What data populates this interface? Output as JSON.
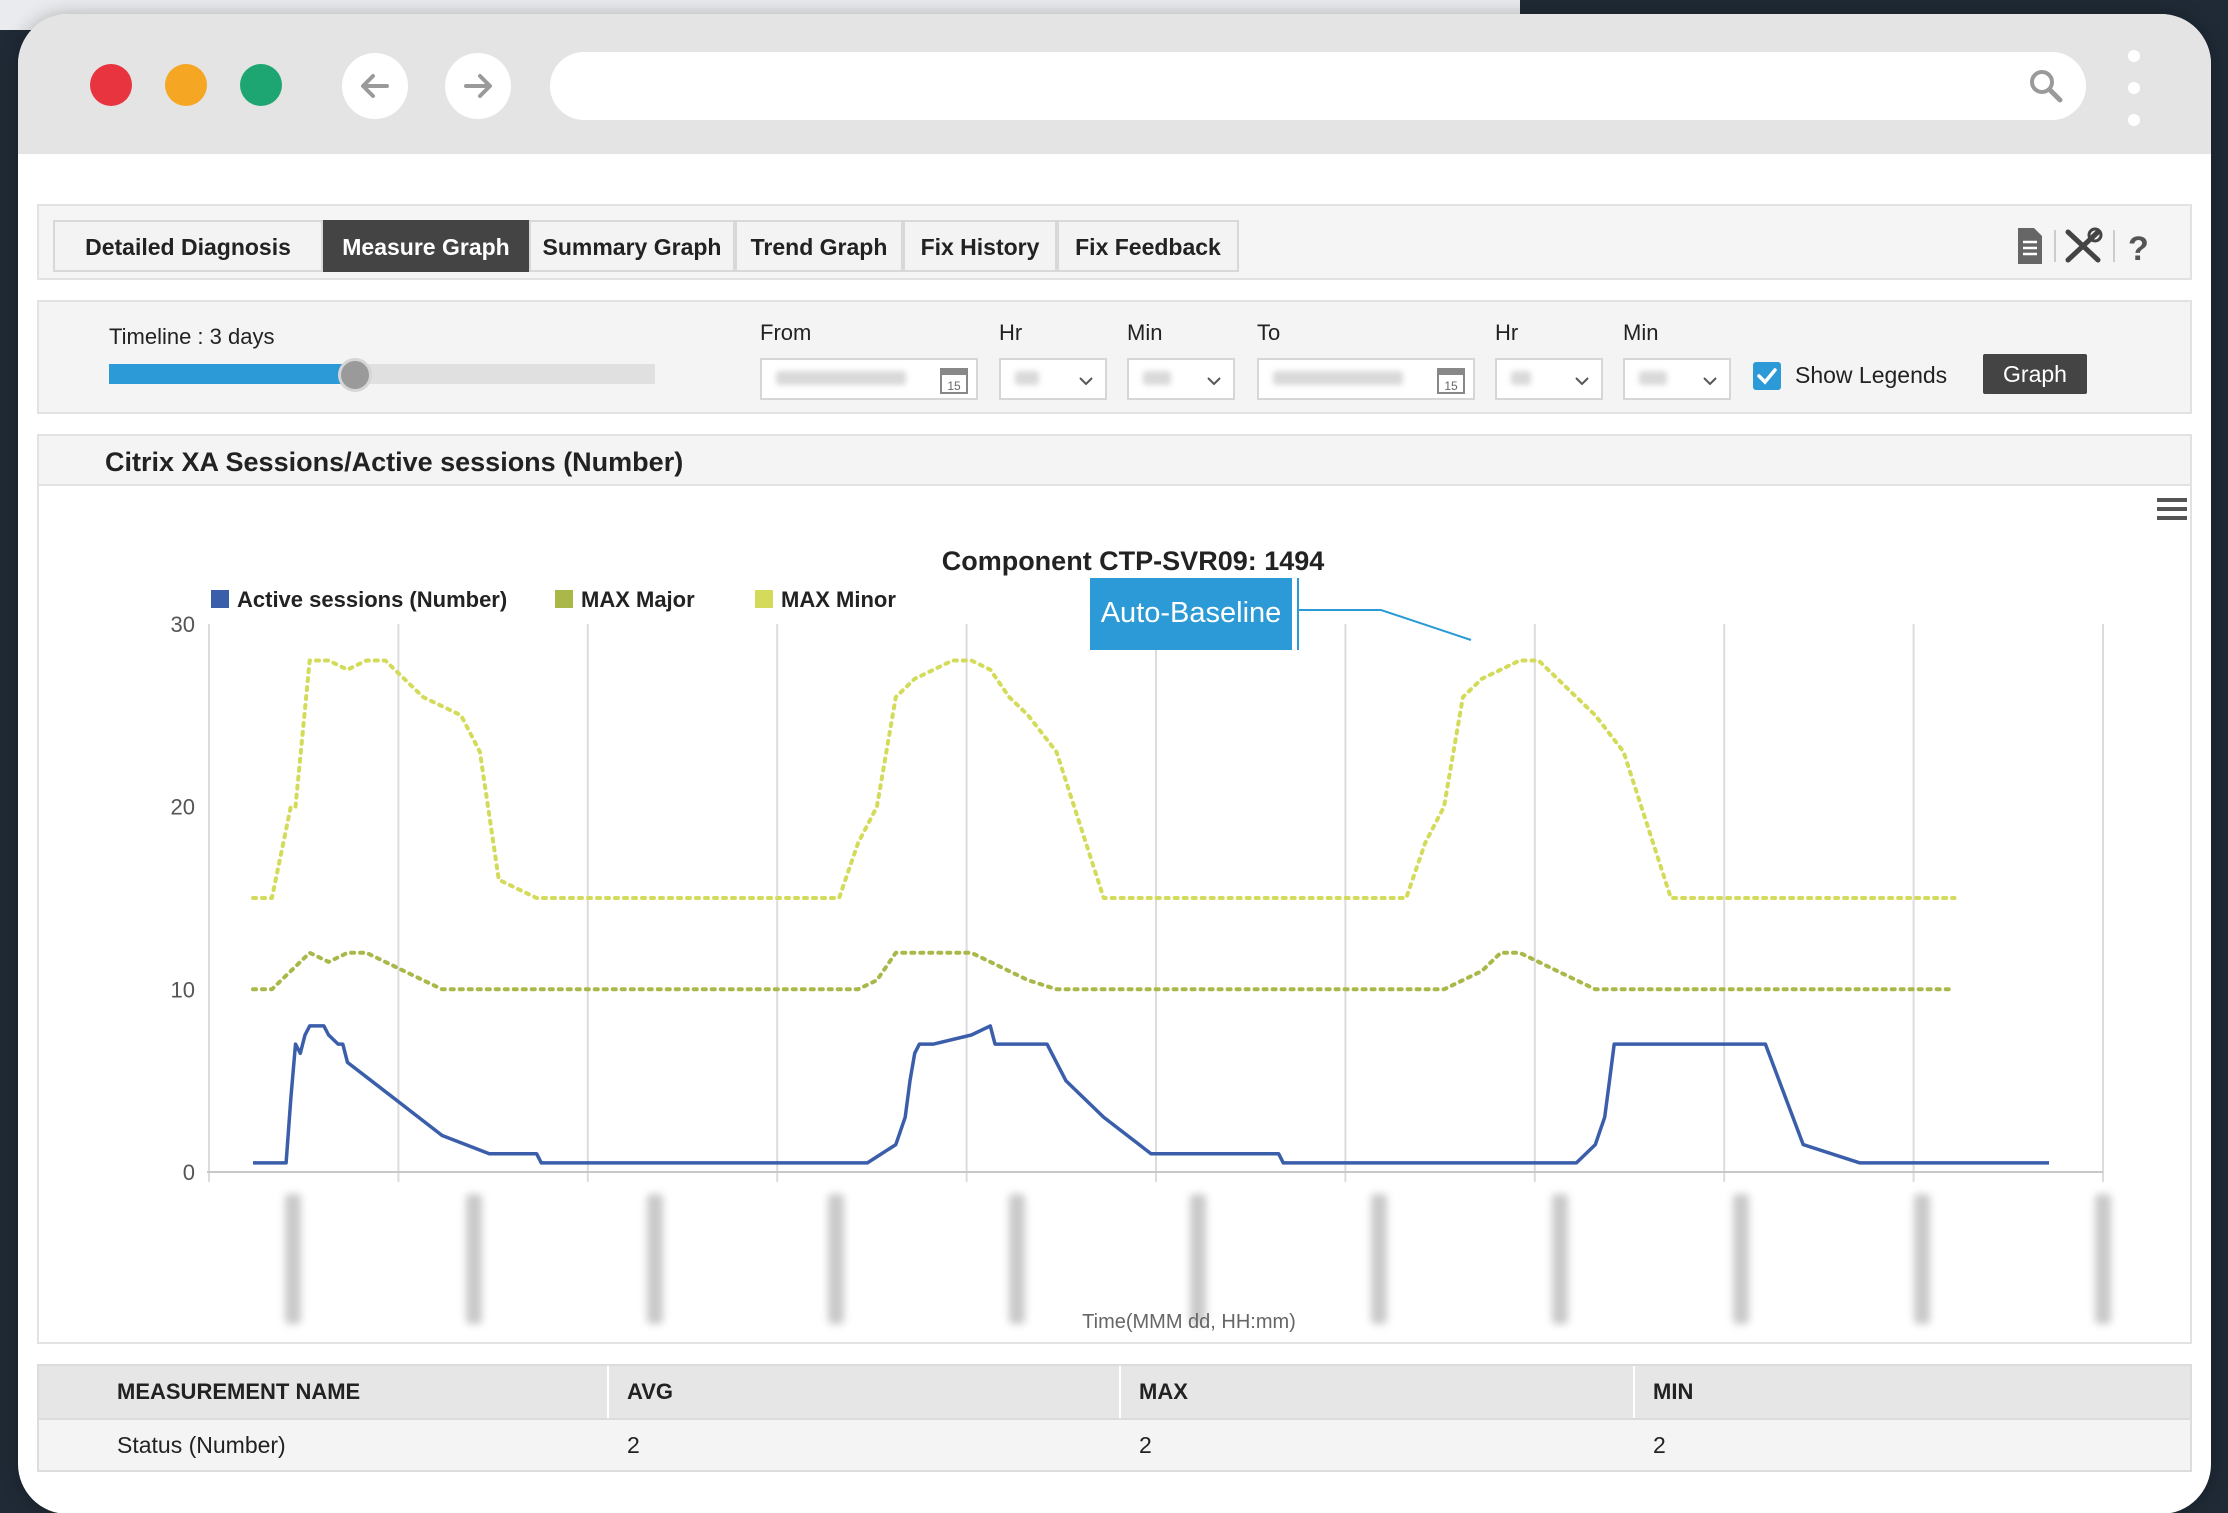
{
  "tabs": [
    {
      "label": "Detailed Diagnosis",
      "active": false
    },
    {
      "label": "Measure Graph",
      "active": true
    },
    {
      "label": "Summary Graph",
      "active": false
    },
    {
      "label": "Trend Graph",
      "active": false
    },
    {
      "label": "Fix History",
      "active": false
    },
    {
      "label": "Fix Feedback",
      "active": false
    }
  ],
  "toolbar_icons": [
    "document-icon",
    "tools-icon",
    "help-icon"
  ],
  "timeline": {
    "label": "Timeline : 3 days",
    "slider_fraction": 0.45,
    "from_label": "From",
    "hr_label": "Hr",
    "min_label": "Min",
    "to_label": "To",
    "calendar_day": "15",
    "show_legends_label": "Show Legends",
    "show_legends_checked": true,
    "graph_button": "Graph"
  },
  "panel": {
    "title": "Citrix XA Sessions/Active sessions (Number)"
  },
  "chart_data": {
    "type": "line",
    "title": "Component CTP-SVR09: 1494",
    "xlabel": "Time(MMM dd, HH:mm)",
    "ylabel": "",
    "ylim": [
      0,
      30
    ],
    "yticks": [
      "0",
      "10",
      "20",
      "30"
    ],
    "grid": true,
    "legend_position": "top-left",
    "annotation": "Auto-Baseline",
    "series": [
      {
        "name": "Active sessions (Number)",
        "color": "#3b5eab",
        "style": "solid",
        "x": [
          0,
          0.2,
          0.35,
          0.4,
          0.45,
          0.5,
          0.55,
          0.6,
          0.65,
          0.75,
          0.8,
          0.9,
          0.95,
          1.0,
          1.5,
          2.0,
          2.5,
          3.0,
          3.05,
          3.1,
          3.15,
          3.2,
          3.3,
          3.4,
          3.45,
          3.5,
          3.6,
          3.8,
          4.0,
          4.4,
          4.5,
          4.9,
          5.0,
          5.5,
          6.0,
          6.5,
          6.8,
          6.9,
          6.95,
          7.0,
          7.05,
          7.1,
          7.15,
          7.2,
          7.6,
          7.8,
          7.85,
          8.0,
          8.2,
          8.4,
          8.6,
          9.0,
          9.5,
          9.8,
          9.9,
          9.95,
          10.0,
          10.1,
          10.5,
          10.85,
          10.9,
          11.0,
          11.05,
          11.1,
          11.15,
          11.2,
          11.3,
          11.5,
          12.0,
          12.5,
          13.0,
          13.5,
          14.0,
          14.2,
          14.3,
          14.35,
          14.4,
          14.5,
          15.0,
          15.5,
          16.0,
          16.4,
          17.0,
          17.5,
          18.0,
          19.0
        ],
        "y": [
          0.5,
          0.5,
          0.5,
          4,
          7,
          6.5,
          7.5,
          8,
          8,
          8,
          7.5,
          7,
          7,
          6,
          4,
          2,
          1,
          1,
          0.5,
          0.5,
          0.5,
          0.5,
          0.5,
          0.5,
          0.5,
          0.5,
          0.5,
          0.5,
          0.5,
          0.5,
          0.5,
          0.5,
          0.5,
          0.5,
          0.5,
          0.5,
          1.5,
          3,
          5,
          6.5,
          7,
          7,
          7,
          7,
          7.5,
          8,
          7,
          7,
          7,
          7,
          5,
          3,
          1,
          1,
          1,
          1,
          1,
          1,
          1,
          1,
          0.5,
          0.5,
          0.5,
          0.5,
          0.5,
          0.5,
          0.5,
          0.5,
          0.5,
          0.5,
          0.5,
          0.5,
          0.5,
          1.5,
          3,
          5,
          7,
          7,
          7,
          7,
          7,
          1.5,
          0.5,
          0.5,
          0.5,
          0.5
        ]
      },
      {
        "name": "MAX Major",
        "color": "#aab84a",
        "style": "dotted",
        "x": [
          0,
          0.2,
          0.4,
          0.6,
          0.8,
          1.0,
          1.2,
          1.4,
          1.6,
          1.8,
          2.0,
          2.5,
          3.0,
          4.0,
          5.0,
          6.0,
          6.2,
          6.4,
          6.6,
          6.8,
          7.0,
          7.2,
          7.4,
          7.6,
          7.8,
          8.0,
          8.2,
          8.5,
          9.0,
          10.0,
          11.0,
          12.0,
          12.2,
          12.4,
          12.6,
          12.8,
          13.0,
          13.2,
          13.4,
          13.6,
          13.8,
          14.0,
          14.2,
          14.5,
          15.0,
          16.0,
          17.0,
          18.0
        ],
        "y": [
          10,
          10,
          11,
          12,
          11.5,
          12,
          12,
          11.5,
          11,
          10.5,
          10,
          10,
          10,
          10,
          10,
          10,
          10,
          10,
          10.5,
          12,
          12,
          12,
          12,
          12,
          11.5,
          11,
          10.5,
          10,
          10,
          10,
          10,
          10,
          10,
          10,
          10,
          10.5,
          11,
          12,
          12,
          11.5,
          11,
          10.5,
          10,
          10,
          10,
          10,
          10,
          10
        ]
      },
      {
        "name": "MAX Minor",
        "color": "#d4db5a",
        "style": "dotted",
        "x": [
          0,
          0.2,
          0.4,
          0.45,
          0.6,
          0.8,
          1.0,
          1.2,
          1.4,
          1.6,
          1.8,
          2.0,
          2.2,
          2.4,
          2.6,
          2.8,
          3.0,
          4.0,
          5.0,
          6.0,
          6.2,
          6.4,
          6.6,
          6.8,
          7.0,
          7.2,
          7.4,
          7.6,
          7.8,
          8.0,
          8.2,
          8.5,
          9.0,
          10.0,
          11.0,
          12.0,
          12.2,
          12.4,
          12.6,
          12.8,
          13.0,
          13.2,
          13.4,
          13.6,
          13.8,
          14.0,
          14.2,
          14.5,
          15.0,
          16.0,
          17.0,
          18.0
        ],
        "y": [
          15,
          15,
          20,
          20,
          28,
          28,
          27.5,
          28,
          28,
          27,
          26,
          25.5,
          25,
          23,
          16,
          15.5,
          15,
          15,
          15,
          15,
          15,
          18,
          20,
          26,
          27,
          27.5,
          28,
          28,
          27.5,
          26,
          25,
          23,
          15,
          15,
          15,
          15,
          15,
          18,
          20,
          26,
          27,
          27.5,
          28,
          28,
          27,
          26,
          25,
          23,
          15,
          15,
          15,
          15
        ]
      }
    ]
  },
  "table": {
    "headers": [
      "MEASUREMENT NAME",
      "AVG",
      "MAX",
      "MIN"
    ],
    "rows": [
      [
        "Status (Number)",
        "2",
        "2",
        "2"
      ]
    ]
  }
}
